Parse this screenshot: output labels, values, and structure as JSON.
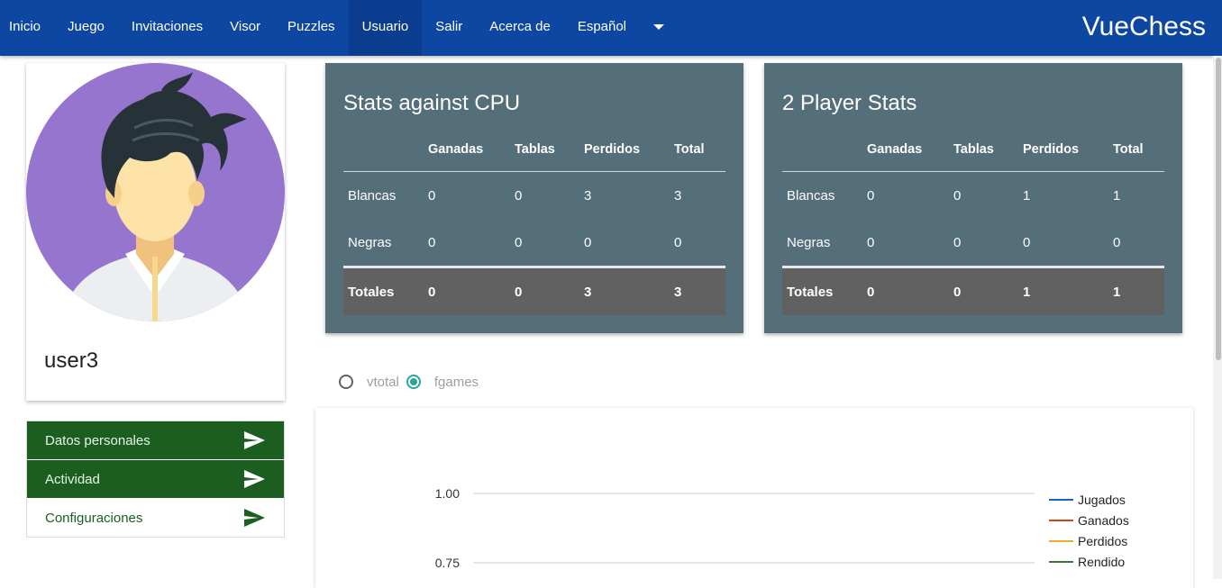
{
  "nav": {
    "items": [
      {
        "label": "Inicio",
        "active": false
      },
      {
        "label": "Juego",
        "active": false
      },
      {
        "label": "Invitaciones",
        "active": false
      },
      {
        "label": "Visor",
        "active": false
      },
      {
        "label": "Puzzles",
        "active": false
      },
      {
        "label": "Usuario",
        "active": true
      },
      {
        "label": "Salir",
        "active": false
      },
      {
        "label": "Acerca de",
        "active": false
      }
    ],
    "language": "Español",
    "brand": "VueChess"
  },
  "profile": {
    "username": "user3",
    "avatar_icon": "user-avatar-icon"
  },
  "side_menu": {
    "items": [
      {
        "label": "Datos personales",
        "icon": "send-icon",
        "style": "dark"
      },
      {
        "label": "Actividad",
        "icon": "send-icon",
        "style": "dark"
      },
      {
        "label": "Configuraciones",
        "icon": "send-icon",
        "style": "light"
      }
    ]
  },
  "stats": [
    {
      "title": "Stats against CPU",
      "headers": [
        "",
        "Ganadas",
        "Tablas",
        "Perdidos",
        "Total"
      ],
      "rows": [
        [
          "Blancas",
          "0",
          "0",
          "3",
          "3"
        ],
        [
          "Negras",
          "0",
          "0",
          "0",
          "0"
        ]
      ],
      "footer": [
        "Totales",
        "0",
        "0",
        "3",
        "3"
      ]
    },
    {
      "title": "2 Player Stats",
      "headers": [
        "",
        "Ganadas",
        "Tablas",
        "Perdidos",
        "Total"
      ],
      "rows": [
        [
          "Blancas",
          "0",
          "0",
          "1",
          "1"
        ],
        [
          "Negras",
          "0",
          "0",
          "0",
          "0"
        ]
      ],
      "footer": [
        "Totales",
        "0",
        "0",
        "1",
        "1"
      ]
    }
  ],
  "chart_options": {
    "options": [
      {
        "label": "vtotal",
        "checked": false
      },
      {
        "label": "fgames",
        "checked": true
      }
    ]
  },
  "chart_data": {
    "type": "line",
    "y_ticks": [
      "1.00",
      "0.75"
    ],
    "series": [
      {
        "name": "Jugados",
        "color": "#1565c0",
        "values": []
      },
      {
        "name": "Ganados",
        "color": "#d84315",
        "values": []
      },
      {
        "name": "Perdidos",
        "color": "#f9a825",
        "values": []
      },
      {
        "name": "Rendido",
        "color": "#2e7d32",
        "values": []
      }
    ],
    "grid": true,
    "legend": "right"
  },
  "colors": {
    "navbar": "#0d47a1",
    "panel": "#546e7a",
    "menu_dark": "#1b5e20",
    "radio_accent": "#26a69a"
  }
}
